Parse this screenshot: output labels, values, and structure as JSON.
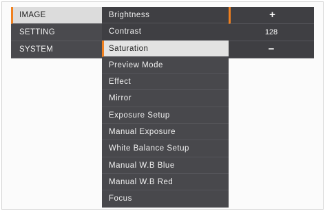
{
  "main_menu": {
    "items": [
      {
        "label": "IMAGE"
      },
      {
        "label": "SETTING"
      },
      {
        "label": "SYSTEM"
      }
    ]
  },
  "sub_menu": {
    "items": [
      {
        "label": "Brightness"
      },
      {
        "label": "Contrast"
      },
      {
        "label": "Saturation"
      },
      {
        "label": "Preview Mode"
      },
      {
        "label": "Effect"
      },
      {
        "label": "Mirror"
      },
      {
        "label": "Exposure Setup"
      },
      {
        "label": "Manual Exposure"
      },
      {
        "label": "White Balance Setup"
      },
      {
        "label": "Manual W.B Blue"
      },
      {
        "label": "Manual W.B Red"
      },
      {
        "label": "Focus"
      }
    ]
  },
  "value_panel": {
    "increase_label": "+",
    "value": "128",
    "decrease_label": "−"
  },
  "colors": {
    "accent": "#f0801f",
    "menu_bg": "#48484c",
    "selected_bg": "#dcdcdc"
  }
}
